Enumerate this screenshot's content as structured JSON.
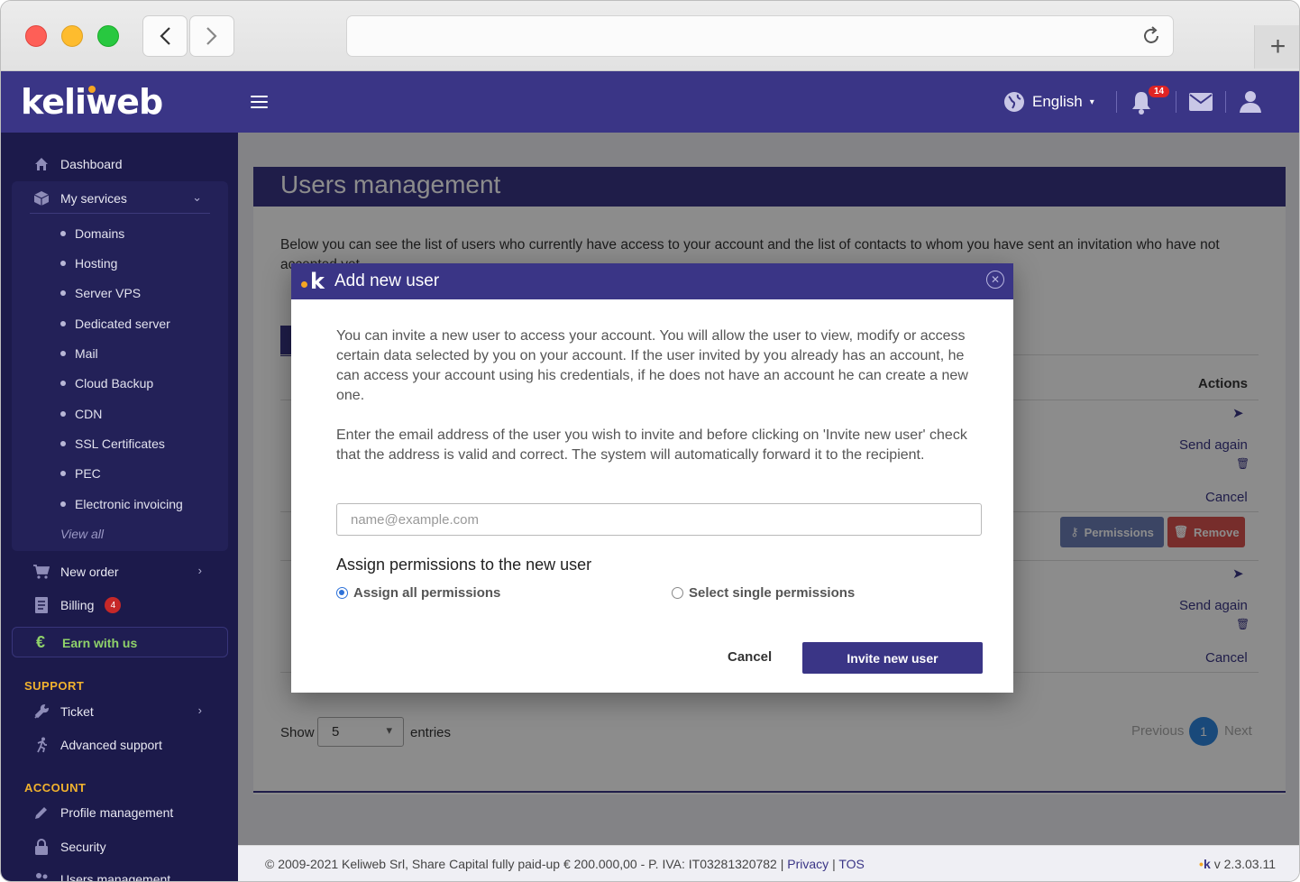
{
  "browser": {
    "back_icon": "chevron-left-icon",
    "forward_icon": "chevron-right-icon",
    "url": "",
    "new_tab_glyph": "+"
  },
  "header": {
    "logo": "keliweb",
    "language": "English",
    "notifications_count": "14"
  },
  "sidebar": {
    "dashboard": "Dashboard",
    "my_services": "My services",
    "services": [
      "Domains",
      "Hosting",
      "Server VPS",
      "Dedicated server",
      "Mail",
      "Cloud Backup",
      "CDN",
      "SSL Certificates",
      "PEC",
      "Electronic invoicing"
    ],
    "view_all": "View all",
    "new_order": "New order",
    "billing": "Billing",
    "billing_badge": "4",
    "earn": "Earn with us",
    "support_title": "SUPPORT",
    "ticket": "Ticket",
    "advanced_support": "Advanced support",
    "account_title": "ACCOUNT",
    "profile_management": "Profile management",
    "security": "Security",
    "users_management": "Users management"
  },
  "main": {
    "title": "Users management",
    "description": "Below you can see the list of users who currently have access to your account and the list of contacts to whom you have sent an invitation who have not accepted yet.",
    "actions_header": "Actions",
    "send_again": "Send again",
    "cancel": "Cancel",
    "permissions": "Permissions",
    "remove": "Remove",
    "show": "Show",
    "entries_value": "5",
    "entries": "entries",
    "previous": "Previous",
    "page": "1",
    "next": "Next"
  },
  "modal": {
    "title": "Add new user",
    "paragraph1": "You can invite a new user to access your account. You will allow the user to view, modify or access certain data selected by you on your account. If the user invited by you already has an account, he can access your account using his credentials, if he does not have an account he can create a new one.",
    "paragraph2": "Enter the email address of the user you wish to invite and before clicking on 'Invite new user' check that the address is valid and correct. The system will automatically forward it to the recipient.",
    "email_placeholder": "name@example.com",
    "email_value": "",
    "permissions_title": "Assign permissions to the new user",
    "radio_all": "Assign all permissions",
    "radio_single": "Select single permissions",
    "selected_radio": "all",
    "cancel": "Cancel",
    "invite": "Invite new user"
  },
  "footer": {
    "copyright": "© 2009-2021 Keliweb Srl, Share Capital fully paid-up € 200.000,00 - P. IVA: IT03281320782 |",
    "privacy": "Privacy",
    "separator": "|",
    "tos": "TOS",
    "version": "v 2.3.03.11"
  },
  "colors": {
    "brand": "#3a3586",
    "sidebar": "#1c1a4b",
    "accent_orange": "#f5a623",
    "earn_green": "#8fd26a",
    "remove_red": "#d9534f"
  }
}
